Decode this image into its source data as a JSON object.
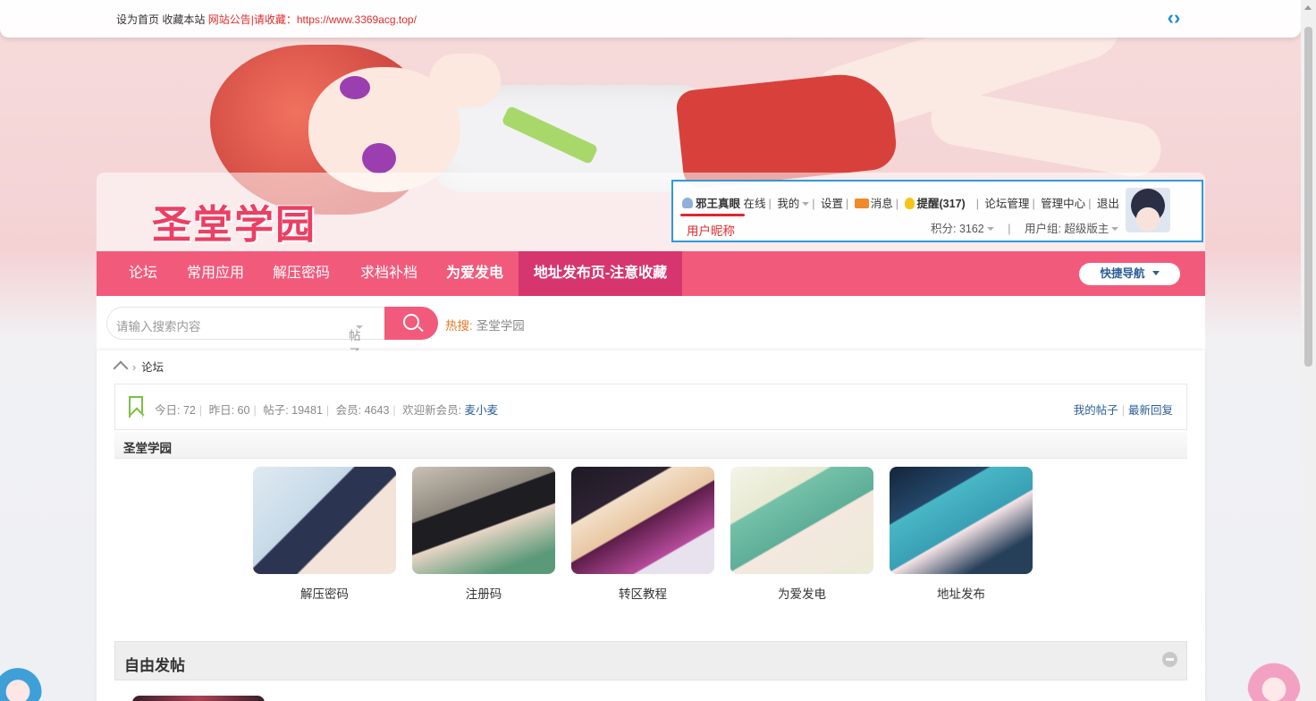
{
  "topbar": {
    "set_home": "设为首页",
    "bookmark": "收藏本站",
    "announcement": "网站公告",
    "collect_text": "|请收藏：https://www.3369acg.top/"
  },
  "logo": {
    "text": "圣堂学园"
  },
  "user": {
    "name": "邪王真眼",
    "status": "在线",
    "mine": "我的",
    "settings": "设置",
    "messages": "消息",
    "reminders": "提醒(317)",
    "forum_admin": "论坛管理",
    "admin_center": "管理中心",
    "logout": "退出",
    "nickname_annotation": "用户昵称",
    "points": "积分: 3162",
    "group": "用户组: 超级版主"
  },
  "nav": {
    "items": [
      {
        "label": "论坛"
      },
      {
        "label": "常用应用"
      },
      {
        "label": "解压密码"
      },
      {
        "label": "求档补档"
      },
      {
        "label": "为爱发电"
      },
      {
        "label": "地址发布页-注意收藏"
      }
    ],
    "quick_nav": "快捷导航"
  },
  "search": {
    "placeholder": "请输入搜索内容",
    "type": "帖子",
    "hot_label": "热搜:",
    "hot_value": "圣堂学园"
  },
  "breadcrumb": {
    "current": "论坛"
  },
  "stats": {
    "today": "今日: 72",
    "yesterday": "昨日: 60",
    "posts": "帖子: 19481",
    "members": "会员: 4643",
    "welcome": "欢迎新会员:",
    "new_member": "麦小麦",
    "my_posts": "我的帖子",
    "latest_reply": "最新回复"
  },
  "section": {
    "title": "圣堂学园",
    "cards": [
      {
        "caption": "解压密码"
      },
      {
        "caption": "注册码"
      },
      {
        "caption": "转区教程"
      },
      {
        "caption": "为爱发电"
      },
      {
        "caption": "地址发布"
      }
    ]
  },
  "free_section": {
    "title": "自由发帖"
  },
  "colors": {
    "accent": "#f25a7c",
    "active": "#d6366d",
    "link": "#2a5e96",
    "annotation": "#e0262e"
  }
}
